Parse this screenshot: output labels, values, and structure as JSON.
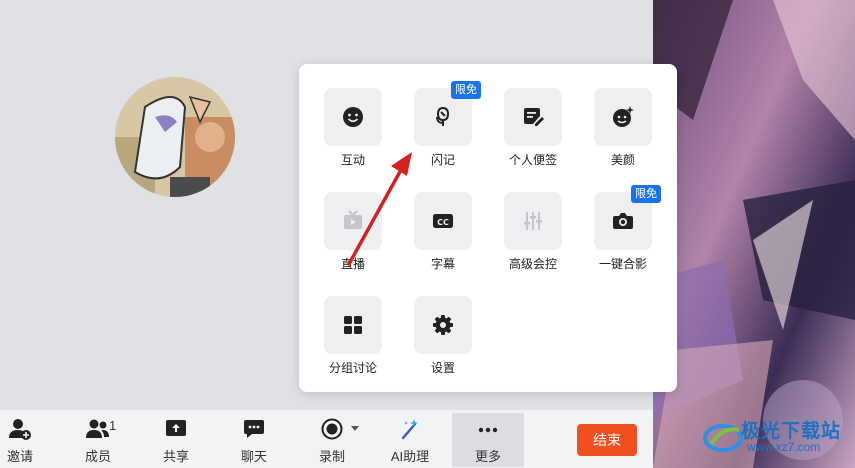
{
  "more_panel": {
    "tiles": [
      {
        "label": "互动",
        "icon": "smile-icon"
      },
      {
        "label": "闪记",
        "icon": "mic-note-icon",
        "badge": "限免"
      },
      {
        "label": "个人便签",
        "icon": "note-edit-icon"
      },
      {
        "label": "美颜",
        "icon": "beauty-face-icon"
      },
      {
        "label": "直播",
        "icon": "live-tv-icon"
      },
      {
        "label": "字幕",
        "icon": "captions-cc-icon"
      },
      {
        "label": "高级会控",
        "icon": "sliders-icon"
      },
      {
        "label": "一键合影",
        "icon": "camera-icon",
        "badge": "限免"
      },
      {
        "label": "分组讨论",
        "icon": "grid-icon"
      },
      {
        "label": "设置",
        "icon": "gear-icon"
      }
    ]
  },
  "toolbar": {
    "invite": "邀请",
    "members": "成员",
    "member_count": "1",
    "share": "共享",
    "chat": "聊天",
    "record": "录制",
    "ai_assistant": "AI助理",
    "more": "更多",
    "end": "结束"
  },
  "watermark": {
    "title": "极光下载站",
    "url": "www.xz7.com"
  },
  "colors": {
    "accent_blue": "#1a73e8",
    "end_button": "#f0501f",
    "annotation_arrow": "#d42020"
  }
}
